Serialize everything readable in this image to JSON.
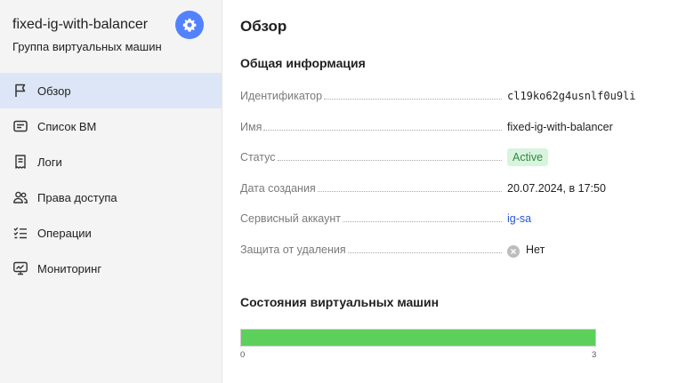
{
  "sidebar": {
    "title": "fixed-ig-with-balancer",
    "subtitle": "Группа виртуальных машин",
    "items": [
      {
        "label": "Обзор",
        "icon": "flag-icon",
        "active": true
      },
      {
        "label": "Список ВМ",
        "icon": "list-card-icon",
        "active": false
      },
      {
        "label": "Логи",
        "icon": "receipt-icon",
        "active": false
      },
      {
        "label": "Права доступа",
        "icon": "persons-icon",
        "active": false
      },
      {
        "label": "Операции",
        "icon": "checklist-icon",
        "active": false
      },
      {
        "label": "Мониторинг",
        "icon": "monitor-chart-icon",
        "active": false
      }
    ],
    "settings_icon": "gear-icon",
    "accent_color": "#5282ff"
  },
  "main": {
    "title": "Обзор",
    "general_section": "Общая информация",
    "fields": {
      "id": {
        "label": "Идентификатор",
        "value": "cl19ko62g4usnlf0u9li"
      },
      "name": {
        "label": "Имя",
        "value": "fixed-ig-with-balancer"
      },
      "status": {
        "label": "Статус",
        "value": "Active"
      },
      "created": {
        "label": "Дата создания",
        "value": "20.07.2024, в 17:50"
      },
      "service_account": {
        "label": "Сервисный аккаунт",
        "value": "ig-sa"
      },
      "deletion_protection": {
        "label": "Защита от удаления",
        "value": "Нет"
      }
    },
    "vm_states_section": "Состояния виртуальных машин",
    "vm_states_bar": {
      "min": "0",
      "max": "3",
      "fill_fraction": 1.0,
      "color": "#5dd05b"
    }
  }
}
